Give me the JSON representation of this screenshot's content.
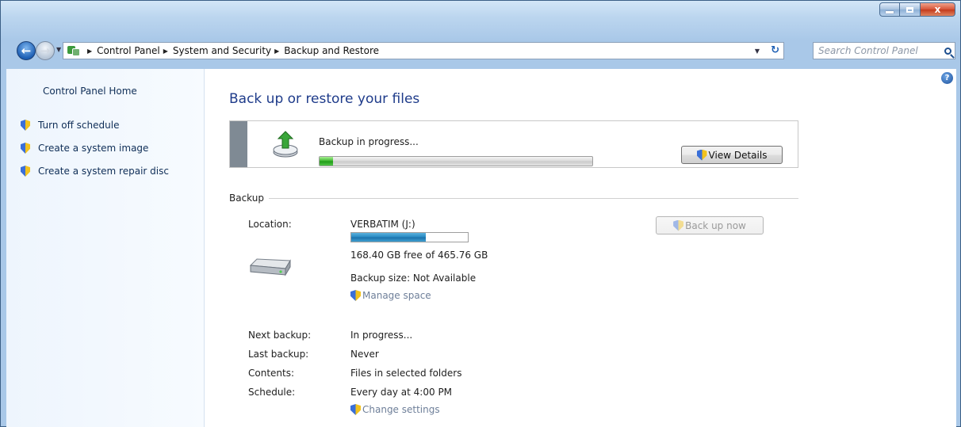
{
  "window": {
    "caption_minimize": "–",
    "caption_maximize": "□",
    "caption_close": "x"
  },
  "address": {
    "crumbs": [
      "Control Panel",
      "System and Security",
      "Backup and Restore"
    ],
    "search_placeholder": "Search Control Panel"
  },
  "sidebar": {
    "home_label": "Control Panel Home",
    "tasks": [
      "Turn off schedule",
      "Create a system image",
      "Create a system repair disc"
    ]
  },
  "main": {
    "title": "Back up or restore your files",
    "progress": {
      "label": "Backup in progress...",
      "fraction": 0.05,
      "view_details_label": "View Details"
    },
    "backup": {
      "section_label": "Backup",
      "location_label": "Location:",
      "location_value": "VERBATIM (J:)",
      "space_fraction": 0.64,
      "free_text": "168.40 GB free of 465.76 GB",
      "size_text": "Backup size: Not Available",
      "manage_space_label": "Manage space",
      "backup_now_label": "Back up now",
      "next_backup_label": "Next backup:",
      "next_backup_value": "In progress...",
      "last_backup_label": "Last backup:",
      "last_backup_value": "Never",
      "contents_label": "Contents:",
      "contents_value": "Files in selected folders",
      "schedule_label": "Schedule:",
      "schedule_value": "Every day at 4:00 PM",
      "change_settings_label": "Change settings"
    }
  },
  "colors": {
    "title_blue": "#1e3b8a",
    "link_gray": "#6e7f99",
    "progress_green": "#38b22a",
    "space_blue": "#2588c2"
  },
  "icons": {
    "back": "back-arrow-icon",
    "forward": "forward-arrow-icon",
    "control_panel": "control-panel-icon",
    "refresh": "refresh-icon",
    "search": "search-icon",
    "help": "help-icon",
    "shield": "uac-shield-icon",
    "backup": "backup-icon",
    "drive": "external-drive-icon"
  }
}
